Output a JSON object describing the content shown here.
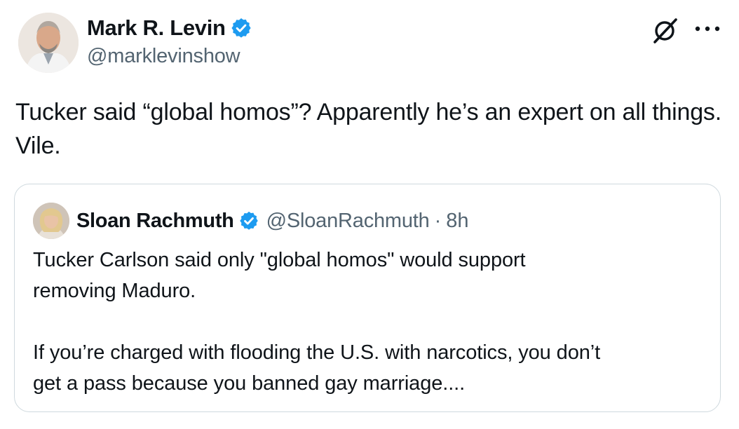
{
  "tweet": {
    "author": {
      "name": "Mark R. Levin",
      "handle": "@marklevinshow",
      "verified": true
    },
    "text": "Tucker said “global homos”?  Apparently he’s an expert on all things.  Vile.",
    "icons": [
      "grok-icon",
      "more-icon",
      "verified-badge-icon"
    ],
    "colors": {
      "verified_blue": "#1d9bf0",
      "handle_gray": "#536471",
      "border": "#cfd9de"
    }
  },
  "quote": {
    "author": {
      "name": "Sloan Rachmuth",
      "handle": "@SloanRachmuth",
      "verified": true
    },
    "separator": "·",
    "time": "8h",
    "text": "Tucker Carlson said only \"global homos\" would support\nremoving Maduro.\n\nIf you’re charged with flooding the U.S. with narcotics, you don’t\nget a pass because you banned gay marriage...."
  }
}
